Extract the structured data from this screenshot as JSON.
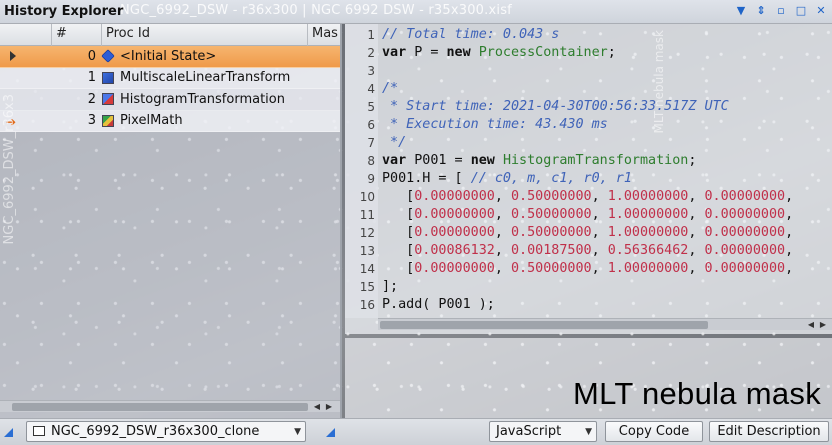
{
  "window": {
    "title": "History Explorer",
    "ghost_title": "NGC_6992_DSW - r36x300 | NGC 6992 DSW - r35x300.xisf"
  },
  "table": {
    "headers": [
      "#",
      "Proc Id",
      "Mas"
    ],
    "rows": [
      {
        "index": "0",
        "proc": "<Initial State>",
        "icon": "initial-state-icon",
        "selected": true,
        "marker": "play-icon"
      },
      {
        "index": "1",
        "proc": "MultiscaleLinearTransform",
        "icon": "mlt-process-icon",
        "selected": false,
        "marker": ""
      },
      {
        "index": "2",
        "proc": "HistogramTransformation",
        "icon": "histogram-process-icon",
        "selected": false,
        "marker": ""
      },
      {
        "index": "3",
        "proc": "PixelMath",
        "icon": "pixelmath-process-icon",
        "selected": false,
        "marker": "current-arrow-icon"
      }
    ],
    "side_text": "NGC_6992_DSW_r36x3"
  },
  "code": {
    "lines": [
      {
        "n": "1",
        "tokens": [
          {
            "t": "// Total time: 0.043 s",
            "c": "cm"
          }
        ]
      },
      {
        "n": "2",
        "tokens": [
          {
            "t": "var",
            "c": "kw"
          },
          {
            "t": " P = ",
            "c": "pl"
          },
          {
            "t": "new",
            "c": "kw"
          },
          {
            "t": " ",
            "c": "pl"
          },
          {
            "t": "ProcessContainer",
            "c": "cls"
          },
          {
            "t": ";",
            "c": "pl"
          }
        ]
      },
      {
        "n": "3",
        "tokens": []
      },
      {
        "n": "4",
        "tokens": [
          {
            "t": "/*",
            "c": "cm"
          }
        ]
      },
      {
        "n": "5",
        "tokens": [
          {
            "t": " * Start time: 2021-04-30T00:56:33.517Z UTC",
            "c": "cm"
          }
        ]
      },
      {
        "n": "6",
        "tokens": [
          {
            "t": " * Execution time: 43.430 ms",
            "c": "cm"
          }
        ]
      },
      {
        "n": "7",
        "tokens": [
          {
            "t": " */",
            "c": "cm"
          }
        ]
      },
      {
        "n": "8",
        "tokens": [
          {
            "t": "var",
            "c": "kw"
          },
          {
            "t": " P001 = ",
            "c": "pl"
          },
          {
            "t": "new",
            "c": "kw"
          },
          {
            "t": " ",
            "c": "pl"
          },
          {
            "t": "HistogramTransformation",
            "c": "cls"
          },
          {
            "t": ";",
            "c": "pl"
          }
        ]
      },
      {
        "n": "9",
        "tokens": [
          {
            "t": "P001.H = [ ",
            "c": "pl"
          },
          {
            "t": "// c0, m, c1, r0, r1",
            "c": "cm"
          }
        ]
      },
      {
        "n": "10",
        "tokens": [
          {
            "t": "   [",
            "c": "pl"
          },
          {
            "t": "0.00000000",
            "c": "num"
          },
          {
            "t": ", ",
            "c": "pl"
          },
          {
            "t": "0.50000000",
            "c": "num"
          },
          {
            "t": ", ",
            "c": "pl"
          },
          {
            "t": "1.00000000",
            "c": "num"
          },
          {
            "t": ", ",
            "c": "pl"
          },
          {
            "t": "0.00000000",
            "c": "num"
          },
          {
            "t": ",",
            "c": "pl"
          }
        ]
      },
      {
        "n": "11",
        "tokens": [
          {
            "t": "   [",
            "c": "pl"
          },
          {
            "t": "0.00000000",
            "c": "num"
          },
          {
            "t": ", ",
            "c": "pl"
          },
          {
            "t": "0.50000000",
            "c": "num"
          },
          {
            "t": ", ",
            "c": "pl"
          },
          {
            "t": "1.00000000",
            "c": "num"
          },
          {
            "t": ", ",
            "c": "pl"
          },
          {
            "t": "0.00000000",
            "c": "num"
          },
          {
            "t": ",",
            "c": "pl"
          }
        ]
      },
      {
        "n": "12",
        "tokens": [
          {
            "t": "   [",
            "c": "pl"
          },
          {
            "t": "0.00000000",
            "c": "num"
          },
          {
            "t": ", ",
            "c": "pl"
          },
          {
            "t": "0.50000000",
            "c": "num"
          },
          {
            "t": ", ",
            "c": "pl"
          },
          {
            "t": "1.00000000",
            "c": "num"
          },
          {
            "t": ", ",
            "c": "pl"
          },
          {
            "t": "0.00000000",
            "c": "num"
          },
          {
            "t": ",",
            "c": "pl"
          }
        ]
      },
      {
        "n": "13",
        "tokens": [
          {
            "t": "   [",
            "c": "pl"
          },
          {
            "t": "0.00086132",
            "c": "num"
          },
          {
            "t": ", ",
            "c": "pl"
          },
          {
            "t": "0.00187500",
            "c": "num"
          },
          {
            "t": ", ",
            "c": "pl"
          },
          {
            "t": "0.56366462",
            "c": "num"
          },
          {
            "t": ", ",
            "c": "pl"
          },
          {
            "t": "0.00000000",
            "c": "num"
          },
          {
            "t": ",",
            "c": "pl"
          }
        ]
      },
      {
        "n": "14",
        "tokens": [
          {
            "t": "   [",
            "c": "pl"
          },
          {
            "t": "0.00000000",
            "c": "num"
          },
          {
            "t": ", ",
            "c": "pl"
          },
          {
            "t": "0.50000000",
            "c": "num"
          },
          {
            "t": ", ",
            "c": "pl"
          },
          {
            "t": "1.00000000",
            "c": "num"
          },
          {
            "t": ", ",
            "c": "pl"
          },
          {
            "t": "0.00000000",
            "c": "num"
          },
          {
            "t": ",",
            "c": "pl"
          }
        ]
      },
      {
        "n": "15",
        "tokens": [
          {
            "t": "];",
            "c": "pl"
          }
        ]
      },
      {
        "n": "16",
        "tokens": [
          {
            "t": "P.add( P001 );",
            "c": "pl"
          }
        ]
      }
    ],
    "side_text": "MLT nebula mask"
  },
  "overlay": {
    "caption": "MLT nebula mask"
  },
  "bottom": {
    "view_select": "NGC_6992_DSW_r36x300_clone",
    "language_select": "JavaScript",
    "copy_code": "Copy Code",
    "edit_description": "Edit Description"
  },
  "colors": {
    "selected_row": "#ef9a4a",
    "comment": "#3f63b8",
    "class_name": "#2e7d2e",
    "number": "#c0304a",
    "accent_icon": "#1f64c8"
  }
}
